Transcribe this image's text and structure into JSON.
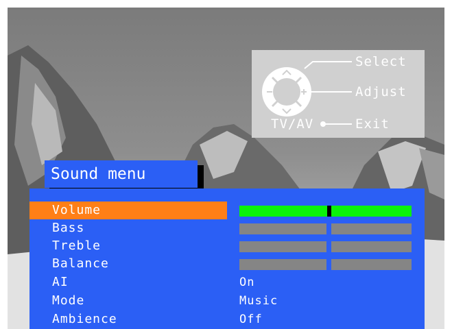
{
  "help_overlay": {
    "select_label": "Select",
    "adjust_label": "Adjust",
    "exit_label": "Exit",
    "tvav_label": "TV/AV"
  },
  "menu": {
    "title": "Sound menu",
    "items": [
      {
        "label": "Volume",
        "type": "slider",
        "level": 0.52,
        "selected": true
      },
      {
        "label": "Bass",
        "type": "slider",
        "selected": false
      },
      {
        "label": "Treble",
        "type": "slider",
        "selected": false
      },
      {
        "label": "Balance",
        "type": "slider",
        "selected": false
      },
      {
        "label": "AI",
        "type": "value",
        "value": "On",
        "selected": false
      },
      {
        "label": "Mode",
        "type": "value",
        "value": "Music",
        "selected": false
      },
      {
        "label": "Ambience",
        "type": "value",
        "value": "Off",
        "selected": false
      }
    ]
  },
  "colors": {
    "menu_bg": "#2b5ff5",
    "highlight": "#ff7f17",
    "active_bar": "#0bf20b",
    "inactive_bar": "#858585"
  }
}
